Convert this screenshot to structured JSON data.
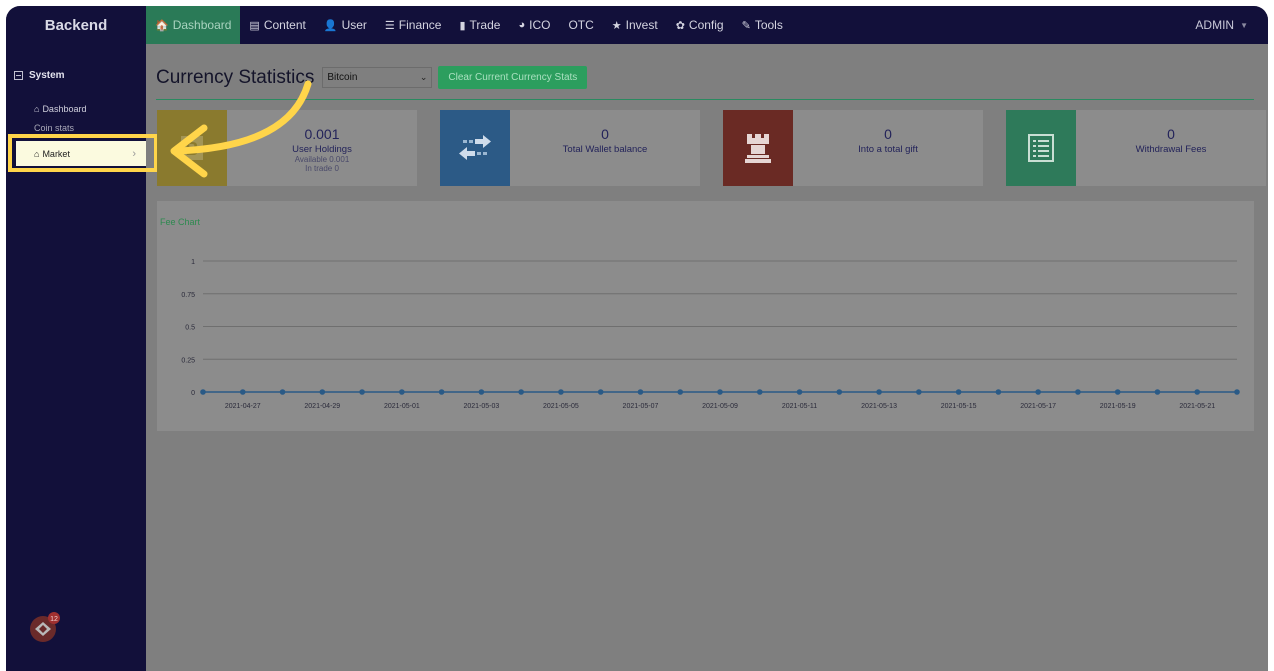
{
  "brand": "Backend",
  "nav": [
    {
      "label": "Dashboard",
      "icon": "home-icon",
      "glyph": "🏠",
      "active": true
    },
    {
      "label": "Content",
      "icon": "document-icon",
      "glyph": "▤",
      "active": false
    },
    {
      "label": "User",
      "icon": "user-icon",
      "glyph": "👤",
      "active": false
    },
    {
      "label": "Finance",
      "icon": "list-icon",
      "glyph": "☰",
      "active": false
    },
    {
      "label": "Trade",
      "icon": "bar-chart-icon",
      "glyph": "▮",
      "active": false
    },
    {
      "label": "ICO",
      "icon": "globe-icon",
      "glyph": "◕",
      "active": false
    },
    {
      "label": "OTC",
      "icon": "",
      "glyph": "",
      "active": false
    },
    {
      "label": "Invest",
      "icon": "star-icon",
      "glyph": "★",
      "active": false
    },
    {
      "label": "Config",
      "icon": "gear-icon",
      "glyph": "✿",
      "active": false
    },
    {
      "label": "Tools",
      "icon": "wrench-icon",
      "glyph": "✎",
      "active": false
    }
  ],
  "admin": "ADMIN",
  "sidebar": {
    "section": "System",
    "dashboard": "Dashboard",
    "coin_stats": "Coin stats",
    "market": "Market"
  },
  "main": {
    "title": "Currency Statistics",
    "currency": "Bitcoin",
    "clear_button": "Clear Current Currency Stats"
  },
  "cards": [
    {
      "value": "0.001",
      "label": "User Holdings",
      "sub1": "Available 0.001",
      "sub2": "In trade 0",
      "color": "#8a7a2e",
      "icon": "bitcoin-icon"
    },
    {
      "value": "0",
      "label": "Total Wallet balance",
      "sub1": "",
      "sub2": "",
      "color": "#2c5a86",
      "icon": "transfer-icon"
    },
    {
      "value": "0",
      "label": "Into a total gift",
      "sub1": "",
      "sub2": "",
      "color": "#6a2a24",
      "icon": "tower-icon"
    },
    {
      "value": "0",
      "label": "Withdrawal Fees",
      "sub1": "",
      "sub2": "",
      "color": "#2e7a5a",
      "icon": "list-box-icon"
    }
  ],
  "chart_data": {
    "type": "line",
    "title": "Fee Chart",
    "x": [
      "2021-04-26",
      "2021-04-27",
      "2021-04-28",
      "2021-04-29",
      "2021-04-30",
      "2021-05-01",
      "2021-05-02",
      "2021-05-03",
      "2021-05-04",
      "2021-05-05",
      "2021-05-06",
      "2021-05-07",
      "2021-05-08",
      "2021-05-09",
      "2021-05-10",
      "2021-05-11",
      "2021-05-12",
      "2021-05-13",
      "2021-05-14",
      "2021-05-15",
      "2021-05-16",
      "2021-05-17",
      "2021-05-18",
      "2021-05-19",
      "2021-05-20",
      "2021-05-21",
      "2021-05-22"
    ],
    "x_tick_labels": [
      "2021-04-27",
      "2021-04-29",
      "2021-05-01",
      "2021-05-03",
      "2021-05-05",
      "2021-05-07",
      "2021-05-09",
      "2021-05-11",
      "2021-05-13",
      "2021-05-15",
      "2021-05-17",
      "2021-05-19",
      "2021-05-21"
    ],
    "y_ticks": [
      "0",
      "0.25",
      "0.5",
      "0.75",
      "1"
    ],
    "ylim": [
      0,
      1
    ],
    "series": [
      {
        "values": [
          0,
          0,
          0,
          0,
          0,
          0,
          0,
          0,
          0,
          0,
          0,
          0,
          0,
          0,
          0,
          0,
          0,
          0,
          0,
          0,
          0,
          0,
          0,
          0,
          0,
          0,
          0
        ]
      }
    ],
    "line_color": "#2a5a86",
    "grid": true
  }
}
